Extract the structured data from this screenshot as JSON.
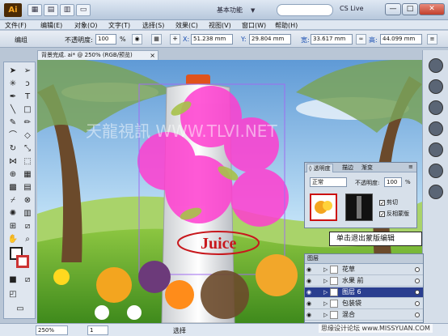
{
  "app": {
    "logo": "Ai"
  },
  "titlebar": {
    "workspace": "基本功能",
    "workspace_arrow": "▼",
    "cslive": "CS Live",
    "buttons": [
      "—",
      "□",
      "✕"
    ]
  },
  "menu": [
    "文件(F)",
    "编辑(E)",
    "对象(O)",
    "文字(T)",
    "选择(S)",
    "效果(C)",
    "视图(V)",
    "窗口(W)",
    "帮助(H)"
  ],
  "control": {
    "mode": "编组",
    "opacity_label": "不透明度:",
    "opacity_value": "100",
    "opacity_unit": "%",
    "x_label": "X:",
    "x_value": "51.238 mm",
    "y_label": "Y:",
    "y_value": "29.804 mm",
    "w_label": "宽:",
    "w_value": "33.617 mm",
    "h_label": "高:",
    "h_value": "44.099 mm"
  },
  "document": {
    "tab_title": "背景完成. ai* @ 250% (RGB/预览)",
    "close": "×"
  },
  "canvas": {
    "watermark_text": "天龍視訊 WWW.TLVI.NET",
    "juice_label": "Juice"
  },
  "transparency": {
    "tabs": [
      "◊ 透明度",
      "描边",
      "渐变"
    ],
    "blend_mode": "正常",
    "opacity_label": "不透明度:",
    "opacity_value": "100",
    "opacity_unit": "%",
    "clip_label": "剪切",
    "invert_label": "反相蒙版"
  },
  "tooltip": "单击退出蒙版编辑",
  "layers": {
    "header": "图层",
    "rows": [
      {
        "name": "花草",
        "selected": false
      },
      {
        "name": "水果 前",
        "selected": false
      },
      {
        "name": "图层 6",
        "selected": true
      },
      {
        "name": "包装袋",
        "selected": false
      },
      {
        "name": "混合",
        "selected": false
      }
    ]
  },
  "status": {
    "zoom": "250%",
    "page": "1",
    "tool": "选择"
  },
  "bottom_watermark": "思缘设计论坛 www.MISSYUAN.COM",
  "colors": {
    "accent": "#2a3e8f",
    "mask_pink": "#ff3dd0",
    "sky": "#7fb6e6"
  }
}
